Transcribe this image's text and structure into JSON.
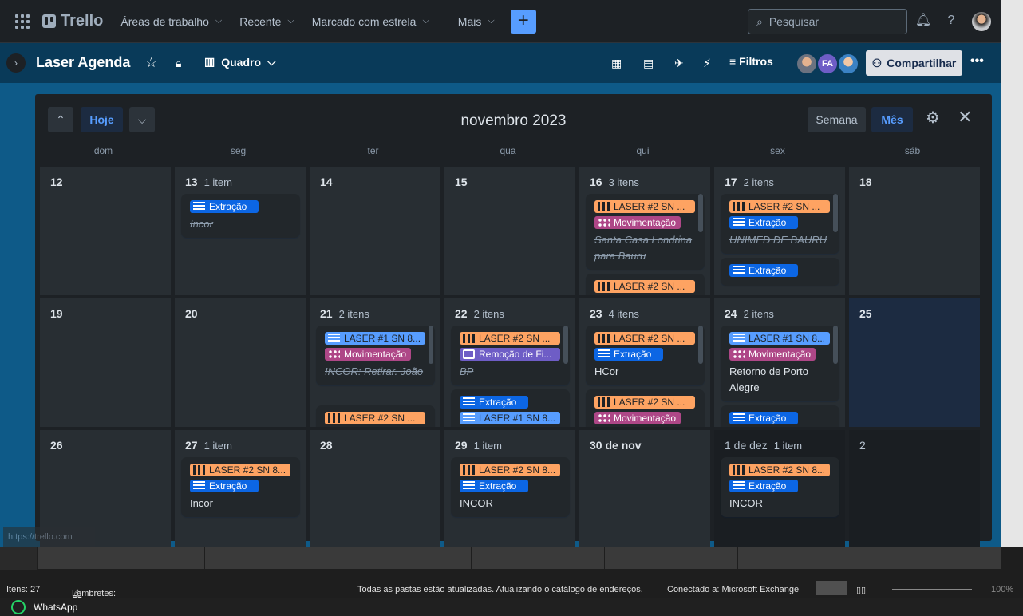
{
  "topbar": {
    "app": "Trello",
    "nav": [
      "Áreas de trabalho",
      "Recente",
      "Marcado com estrela",
      "Mais"
    ],
    "create": "+",
    "search_placeholder": "Pesquisar"
  },
  "board": {
    "title": "Laser Agenda",
    "view": "Quadro",
    "filters": "Filtros",
    "share": "Compartilhar",
    "member_initials": "FA"
  },
  "calendar": {
    "title": "novembro 2023",
    "today": "Hoje",
    "week": "Semana",
    "month": "Mês",
    "days_of_week": [
      "dom",
      "seg",
      "ter",
      "qua",
      "qui",
      "sex",
      "sáb"
    ],
    "weeks": [
      [
        {
          "day": "12"
        },
        {
          "day": "13",
          "count": "1 item",
          "cards": [
            {
              "labels": [
                {
                  "type": "blue",
                  "icon": "lines",
                  "text": "Extração"
                }
              ],
              "title": "Incor",
              "done": true
            }
          ]
        },
        {
          "day": "14"
        },
        {
          "day": "15"
        },
        {
          "day": "16",
          "count": "3 itens",
          "scroll": true,
          "cards": [
            {
              "labels": [
                {
                  "type": "orange",
                  "icon": "bars",
                  "text": "LASER #2 SN ..."
                },
                {
                  "type": "purple",
                  "icon": "dots",
                  "text": "Movimentação"
                }
              ],
              "title": "Santa Casa Londrina para Bauru",
              "done": true
            },
            {
              "labels": [
                {
                  "type": "orange",
                  "icon": "bars",
                  "text": "LASER #2 SN ..."
                }
              ],
              "title": ""
            }
          ]
        },
        {
          "day": "17",
          "count": "2 itens",
          "scroll": true,
          "cards": [
            {
              "labels": [
                {
                  "type": "orange",
                  "icon": "bars",
                  "text": "LASER #2 SN ..."
                },
                {
                  "type": "blue",
                  "icon": "lines",
                  "text": "Extração"
                }
              ],
              "title": "UNIMED DE BAURU",
              "done": true
            },
            {
              "labels": [
                {
                  "type": "blue",
                  "icon": "lines",
                  "text": "Extração"
                }
              ],
              "title": ""
            }
          ]
        },
        {
          "day": "18"
        }
      ],
      [
        {
          "day": "19"
        },
        {
          "day": "20"
        },
        {
          "day": "21",
          "count": "2 itens",
          "scroll": true,
          "cards": [
            {
              "labels": [
                {
                  "type": "lblue",
                  "icon": "lines",
                  "text": "LASER #1 SN 8..."
                },
                {
                  "type": "purple",
                  "icon": "dots",
                  "text": "Movimentação"
                }
              ],
              "title": "INCOR: Retirar. João",
              "done": true
            },
            {
              "labels": [
                {
                  "type": "orange",
                  "icon": "bars",
                  "text": "LASER #2 SN ..."
                }
              ],
              "title": ""
            }
          ]
        },
        {
          "day": "22",
          "count": "2 itens",
          "scroll": true,
          "cards": [
            {
              "labels": [
                {
                  "type": "orange",
                  "icon": "bars",
                  "text": "LASER #2 SN ..."
                },
                {
                  "type": "violet",
                  "icon": "flow",
                  "text": "Remoção de Fi..."
                }
              ],
              "title": "BP",
              "done": true
            },
            {
              "labels": [
                {
                  "type": "blue",
                  "icon": "lines",
                  "text": "Extração"
                },
                {
                  "type": "lblue",
                  "icon": "lines",
                  "text": "LASER #1 SN 8..."
                }
              ],
              "title": ""
            }
          ]
        },
        {
          "day": "23",
          "count": "4 itens",
          "scroll": true,
          "cards": [
            {
              "labels": [
                {
                  "type": "orange",
                  "icon": "bars",
                  "text": "LASER #2 SN ..."
                },
                {
                  "type": "blue",
                  "icon": "lines",
                  "text": "Extração"
                }
              ],
              "title": "HCor",
              "done": false
            },
            {
              "labels": [
                {
                  "type": "orange",
                  "icon": "bars",
                  "text": "LASER #2 SN ..."
                },
                {
                  "type": "purple",
                  "icon": "dots",
                  "text": "Movimentação"
                }
              ],
              "title": ""
            }
          ]
        },
        {
          "day": "24",
          "count": "2 itens",
          "scroll": true,
          "cards": [
            {
              "labels": [
                {
                  "type": "lblue",
                  "icon": "lines",
                  "text": "LASER #1 SN 8..."
                },
                {
                  "type": "purple",
                  "icon": "dots",
                  "text": "Movimentação"
                }
              ],
              "title": "Retorno de Porto Alegre",
              "done": false
            },
            {
              "labels": [
                {
                  "type": "blue",
                  "icon": "lines",
                  "text": "Extração"
                }
              ],
              "title": ""
            }
          ]
        },
        {
          "day": "25",
          "today": true
        }
      ],
      [
        {
          "day": "26"
        },
        {
          "day": "27",
          "count": "1 item",
          "cards": [
            {
              "labels": [
                {
                  "type": "orange",
                  "icon": "bars",
                  "text": "LASER #2 SN 8..."
                },
                {
                  "type": "blue",
                  "icon": "lines",
                  "text": "Extração"
                }
              ],
              "title": "Incor",
              "done": false
            }
          ]
        },
        {
          "day": "28"
        },
        {
          "day": "29",
          "count": "1 item",
          "cards": [
            {
              "labels": [
                {
                  "type": "orange",
                  "icon": "bars",
                  "text": "LASER #2 SN 8..."
                },
                {
                  "type": "blue",
                  "icon": "lines",
                  "text": "Extração"
                }
              ],
              "title": "INCOR",
              "done": false
            }
          ]
        },
        {
          "day": "30 de nov"
        },
        {
          "day": "1 de dez",
          "count": "1 item",
          "other": true,
          "cards": [
            {
              "labels": [
                {
                  "type": "orange",
                  "icon": "bars",
                  "text": "LASER #2 SN 8..."
                },
                {
                  "type": "blue",
                  "icon": "lines",
                  "text": "Extração"
                }
              ],
              "title": "INCOR",
              "done": false
            }
          ]
        },
        {
          "day": "2",
          "other": true
        }
      ]
    ]
  },
  "link_preview": "https://trello.com",
  "statusbar": {
    "items": "Itens: 27",
    "reminders": "Lembretes: 6",
    "sync": "Todas as pastas estão atualizadas.  Atualizando o catálogo de endereços.",
    "connected": "Conectado a: Microsoft Exchange",
    "zoom": "100%"
  },
  "taskbar": {
    "app": "WhatsApp"
  }
}
